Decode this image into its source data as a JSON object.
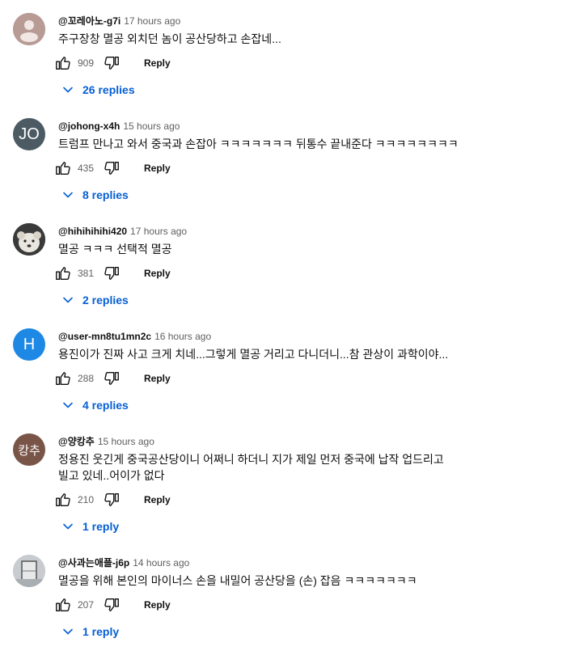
{
  "comments": [
    {
      "handle": "@꼬레아노-g7i",
      "time": "17 hours ago",
      "text": "주구장창 멸공 외치던 놈이 공산당하고 손잡네...",
      "likes": "909",
      "reply_label": "Reply",
      "replies_label": "26 replies",
      "avatar": {
        "type": "default-person",
        "bg": "#b79b94"
      }
    },
    {
      "handle": "@johong-x4h",
      "time": "15 hours ago",
      "text": "트럼프 만나고 와서 중국과 손잡아 ㅋㅋㅋㅋㅋㅋㅋ 뒤통수 끝내준다 ㅋㅋㅋㅋㅋㅋㅋㅋ",
      "likes": "435",
      "reply_label": "Reply",
      "replies_label": "8 replies",
      "avatar": {
        "type": "initials",
        "initials": "JO",
        "bg": "#4b5a63"
      }
    },
    {
      "handle": "@hihihihihi420",
      "time": "17 hours ago",
      "text": "멸공 ㅋㅋㅋ 선택적 멸공",
      "likes": "381",
      "reply_label": "Reply",
      "replies_label": "2 replies",
      "avatar": {
        "type": "photo-dog",
        "bg": "#3a3a3a"
      }
    },
    {
      "handle": "@user-mn8tu1mn2c",
      "time": "16 hours ago",
      "text": "용진이가 진짜 사고 크게 치네...그렇게 멸공 거리고 다니더니...참 관상이 과학이야...",
      "likes": "288",
      "reply_label": "Reply",
      "replies_label": "4 replies",
      "avatar": {
        "type": "initials",
        "initials": "H",
        "bg": "#1e88e5"
      }
    },
    {
      "handle": "@양캉추",
      "time": "15 hours ago",
      "text": "정용진 웃긴게 중국공산당이니 어쩌니 하더니 지가 제일 먼저 중국에 납작 업드리고 빌고 있네..어이가 없다",
      "likes": "210",
      "reply_label": "Reply",
      "replies_label": "1 reply",
      "avatar": {
        "type": "initials",
        "initials": "캉추",
        "bg": "#795548"
      }
    },
    {
      "handle": "@사과는애플-j6p",
      "time": "14 hours ago",
      "text": "멸공을 위해 본인의 마이너스 손을 내밀어 공산당을 (손) 잡음 ㅋㅋㅋㅋㅋㅋㅋ",
      "likes": "207",
      "reply_label": "Reply",
      "replies_label": "1 reply",
      "avatar": {
        "type": "photo-window",
        "bg": "#c8ccd0"
      }
    }
  ]
}
